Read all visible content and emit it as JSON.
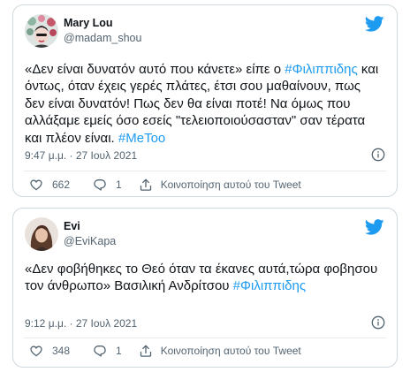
{
  "colors": {
    "link": "#1d9bf0",
    "secondary_text": "#536471",
    "border": "#cfd9de",
    "primary_text": "#0f1419"
  },
  "tweets": [
    {
      "display_name": "Mary Lou",
      "handle": "@madam_shou",
      "avatar_icon": "woman-with-flowers-avatar",
      "text_part1": "«Δεν είναι δυνατόν αυτό που κάνετε» είπε ο ",
      "hashtag1": "#Φιλιππιδης",
      "text_part2": " και όντως, όταν έχεις γερές πλάτες, έτσι σου μαθαίνουν, πως δεν είναι δυνατόν! Πως δεν θα είναι ποτέ! Να όμως που αλλάξαμε εμείς όσο εσείς  \"τελειοποιούσασταν\" σαν τέρατα και πλέον είναι. ",
      "hashtag2": "#MeToo",
      "timestamp": "9:47 μ.μ. · 27 Ιουλ 2021",
      "likes": "662",
      "replies": "1",
      "share_label": "Κοινοποίηση αυτού του Tweet"
    },
    {
      "display_name": "Evi",
      "handle": "@EviKapa",
      "avatar_icon": "woman-portrait-avatar",
      "text_part1": "«Δεν φοβήθηκες το Θεό όταν τα έκανες αυτά,τώρα φοβησου τον άνθρωπο» Βασιλική Ανδρίτσου ",
      "hashtag1": "#Φιλιππιδης",
      "timestamp": "9:12 μ.μ. · 27 Ιουλ 2021",
      "likes": "348",
      "replies": "1",
      "share_label": "Κοινοποίηση αυτού του Tweet"
    }
  ]
}
